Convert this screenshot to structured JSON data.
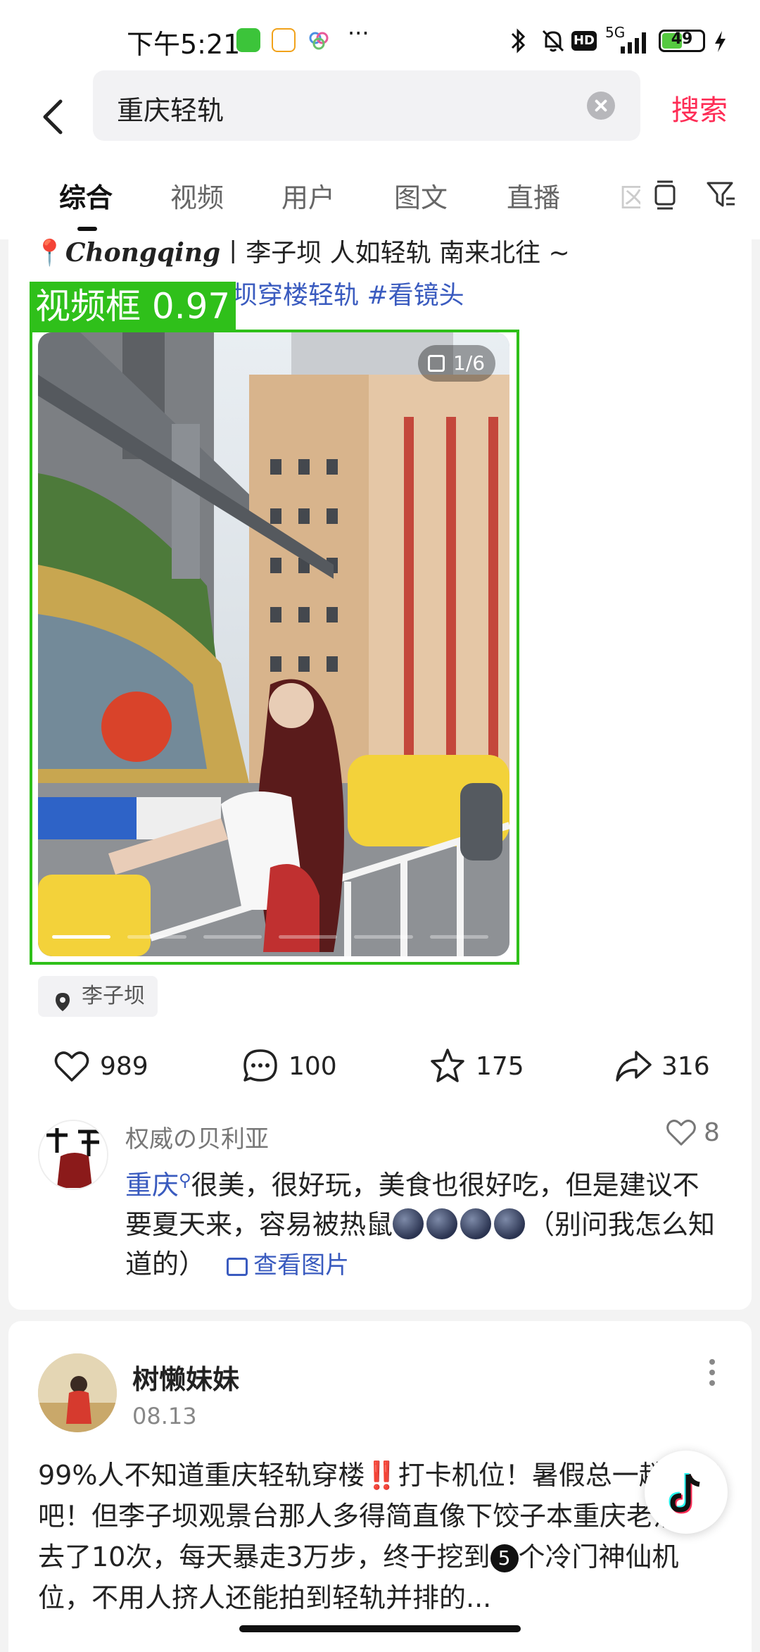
{
  "status_bar": {
    "time": "下午5:21",
    "app_icons": [
      "wechat-icon",
      "58-app-icon",
      "cloud-app-icon"
    ],
    "more": "···",
    "network": "5G",
    "hd": "HD",
    "battery": "49"
  },
  "header": {
    "search_query": "重庆轻轨",
    "search_button": "搜索"
  },
  "tabs": {
    "items": [
      "综合",
      "视频",
      "用户",
      "图文",
      "直播"
    ],
    "active": "综合",
    "partial": "区"
  },
  "post1": {
    "caption_line1_italic": "Chongqing",
    "caption_line1_rest": "丨李子坝           人如轻轨  南来北往 ~",
    "caption_line2": "坝穿楼轻轨 #看镜头",
    "image_counter": "1/6",
    "detection_label": "视频框 0.97",
    "location": "李子坝",
    "actions": {
      "likes": "989",
      "comments": "100",
      "favorites": "175",
      "shares": "316"
    },
    "top_comment": {
      "user": "权威の贝利亚",
      "likes": "8",
      "tag": "重庆",
      "text_after_tag": "很美，很好玩，美食也很好吃，但是建议不要夏天来，容易被热鼠",
      "text_tail": "（别问我怎么知道的）",
      "view_image": "查看图片"
    }
  },
  "post2": {
    "user": "树懒妹妹",
    "date": "08.13",
    "text_part1": "99%人不知道重庆轻轨穿楼‼️打卡机位！暑假总一趟重庆吧！但李子坝观景台那人多得简直像下饺子本重庆老油条去了10次，每天暴走3万步，终于挖到",
    "badge": "5",
    "text_part2": "个冷门神仙机位，不用人挤人还能拍到轻轨并排的..."
  },
  "colors": {
    "accent": "#fe2c55",
    "link": "#3a5bbf",
    "detection": "#2fc01a"
  }
}
